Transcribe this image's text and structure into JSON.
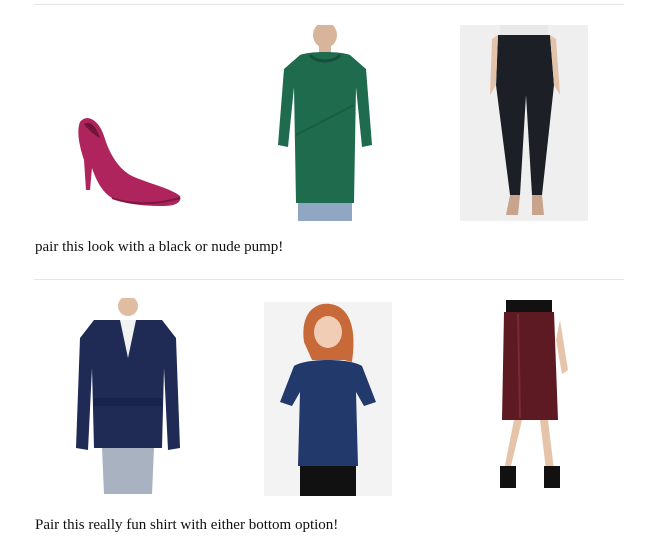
{
  "sections": [
    {
      "caption": "pair this look with a black or nude pump!",
      "products": [
        {
          "name": "magenta suede pointed pump",
          "icon": "pump-shoe-icon",
          "color": "#b0245e"
        },
        {
          "name": "green ribbed tunic sweater",
          "icon": "sweater-icon",
          "color": "#1f6b4e"
        },
        {
          "name": "black skinny jeans",
          "icon": "jeans-icon",
          "color": "#1c1f26"
        }
      ]
    },
    {
      "caption": "Pair this really fun shirt with either bottom option!",
      "products": [
        {
          "name": "navy belted blazer",
          "icon": "blazer-icon",
          "color": "#1f2a55"
        },
        {
          "name": "navy blouse",
          "icon": "blouse-icon",
          "color": "#223a6b"
        },
        {
          "name": "burgundy leather pencil skirt",
          "icon": "skirt-icon",
          "color": "#5e1a22"
        }
      ]
    }
  ]
}
